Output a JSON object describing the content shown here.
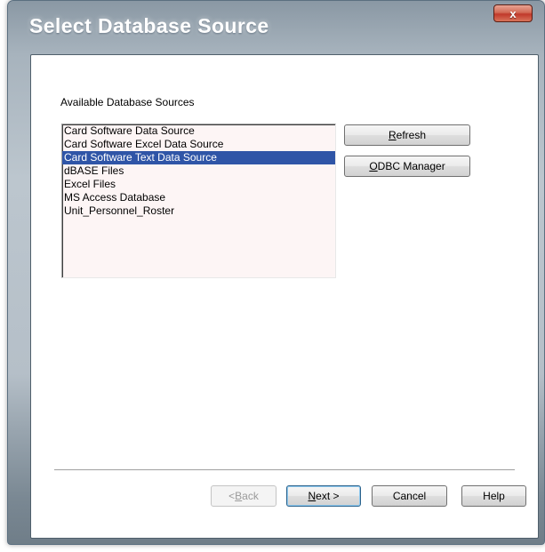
{
  "window": {
    "title": "Select Database Source",
    "close_glyph": "x"
  },
  "sources": {
    "label": "Available Database Sources",
    "items": [
      "Card Software Data Source",
      "Card Software Excel Data Source",
      "Card Software Text Data Source",
      "dBASE Files",
      "Excel Files",
      "MS Access Database",
      "Unit_Personnel_Roster"
    ],
    "selected_index": 2
  },
  "side_buttons": {
    "refresh": {
      "mnemonic": "R",
      "rest": "efresh"
    },
    "odbc": {
      "mnemonic": "O",
      "rest": "DBC Manager"
    }
  },
  "footer": {
    "back": {
      "prefix": "< ",
      "mnemonic": "B",
      "rest": "ack"
    },
    "next": {
      "mnemonic": "N",
      "rest": "ext >"
    },
    "cancel": "Cancel",
    "help": "Help"
  },
  "colors": {
    "selection": "#2f55a7",
    "close_button": "#c0392b"
  }
}
